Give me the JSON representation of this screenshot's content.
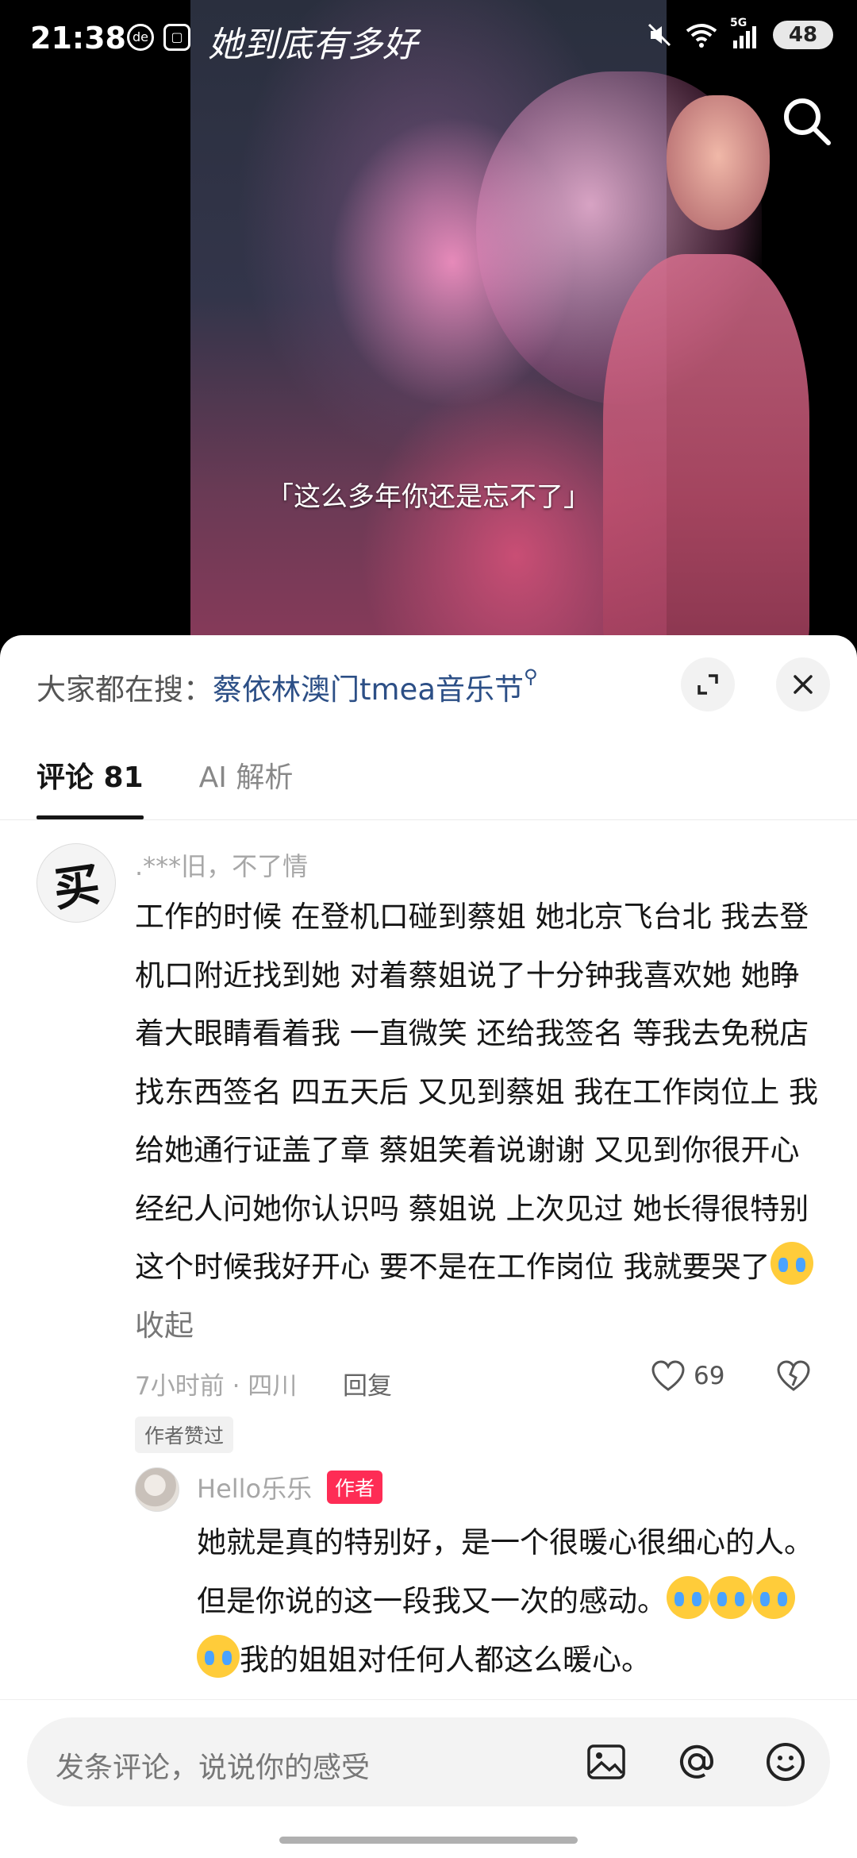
{
  "status_bar": {
    "time": "21:38",
    "left_icons": [
      "de-icon",
      "scan-icon",
      "app-icon"
    ],
    "right_icons": [
      "mute-icon",
      "wifi-icon",
      "signal-5g-icon"
    ],
    "network_label": "5G",
    "battery": "48"
  },
  "video": {
    "title": "她到底有多好",
    "subtitle": "「这么多年你还是忘不了」"
  },
  "sheet": {
    "trending_label": "大家都在搜：",
    "trending_term": "蔡依林澳门tmea音乐节",
    "tabs": [
      {
        "label": "评论 81",
        "active": true
      },
      {
        "label": "AI 解析",
        "active": false
      }
    ]
  },
  "comment": {
    "avatar_text": "买",
    "username": ".***旧，不了情",
    "text": "工作的时候  在登机口碰到蔡姐  她北京飞台北  我去登机口附近找到她  对着蔡姐说了十分钟我喜欢她  她睁着大眼睛看着我  一直微笑  还给我签名  等我去免税店找东西签名   四五天后  又见到蔡姐  我在工作岗位上  我给她通行证盖了章  蔡姐笑着说谢谢  又见到你很开心  经纪人问她你认识吗  蔡姐说  上次见过  她长得很特别  这个时候我好开心  要不是在工作岗位  我就要哭了",
    "collapse": "收起",
    "meta": "7小时前 · 四川",
    "reply_label": "回复",
    "likes": "69",
    "author_liked_tag": "作者赞过"
  },
  "reply": {
    "username": "Hello乐乐",
    "badge": "作者",
    "text_part1": "她就是真的特别好，是一个很暖心很细心的人。但是你说的这一段我又一次的感动。",
    "text_part2": "我的姐姐对任何人都这么暖心。"
  },
  "input": {
    "placeholder": "发条评论，说说你的感受"
  },
  "colors": {
    "accent_red": "#fe2c55",
    "trending_blue": "#2c4f86",
    "emoji_yellow": "#ffcc3a"
  }
}
